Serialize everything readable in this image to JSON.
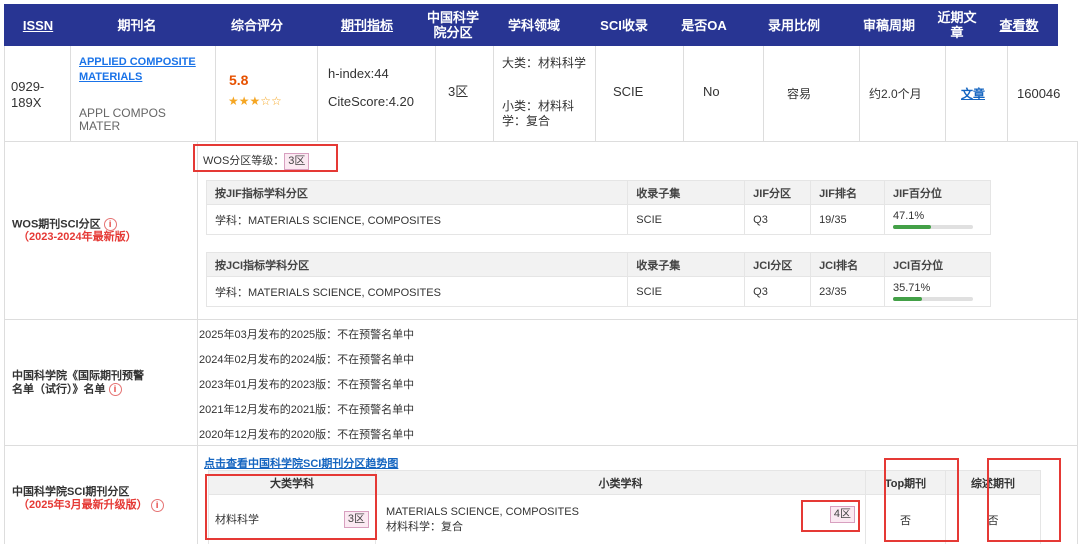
{
  "header": {
    "issn": "ISSN",
    "name": "期刊名",
    "score": "综合评分",
    "metrics": "期刊指标",
    "cas_zone": "中国科学院分区",
    "field": "学科领域",
    "sci": "SCI收录",
    "oa": "是否OA",
    "acceptance": "录用比例",
    "review": "审稿周期",
    "recent": "近期文章",
    "views": "查看数"
  },
  "journal": {
    "issn": "0929-189X",
    "title": "APPLIED COMPOSITE MATERIALS",
    "abbr": "APPL COMPOS MATER",
    "score": "5.8",
    "stars": "★★★☆☆",
    "hindex": "h-index:44",
    "citescore": "CiteScore:4.20",
    "zone": "3区",
    "field_major": "大类：材料科学",
    "field_minor": "小类：材料科学：复合",
    "sci": "SCIE",
    "oa": "No",
    "acceptance": "容易",
    "review": "约2.0个月",
    "recent": "文章",
    "views": "160046"
  },
  "wos": {
    "label": "WOS期刊SCI分区",
    "sub_label": "（2023-2024年最新版）",
    "grade_label": "WOS分区等级：",
    "grade": "3区",
    "jif": {
      "headers": [
        "按JIF指标学科分区",
        "收录子集",
        "JIF分区",
        "JIF排名",
        "JIF百分位"
      ],
      "subject": "学科：MATERIALS SCIENCE, COMPOSITES",
      "collection": "SCIE",
      "quartile": "Q3",
      "rank": "19/35",
      "percentile": "47.1%",
      "percentile_value": 47.1
    },
    "jci": {
      "headers": [
        "按JCI指标学科分区",
        "收录子集",
        "JCI分区",
        "JCI排名",
        "JCI百分位"
      ],
      "subject": "学科：MATERIALS SCIENCE, COMPOSITES",
      "collection": "SCIE",
      "quartile": "Q3",
      "rank": "23/35",
      "percentile": "35.71%",
      "percentile_value": 35.71
    }
  },
  "warning": {
    "label_line1": "中国科学院《国际期刊预警",
    "label_line2": "名单（试行）》名单",
    "lines": [
      "2025年03月发布的2025版：不在预警名单中",
      "2024年02月发布的2024版：不在预警名单中",
      "2023年01月发布的2023版：不在预警名单中",
      "2021年12月发布的2021版：不在预警名单中",
      "2020年12月发布的2020版：不在预警名单中"
    ]
  },
  "cas": {
    "label": "中国科学院SCI期刊分区",
    "sub_label": "（2025年3月最新升级版）",
    "trend_link": "点击查看中国科学院SCI期刊分区趋势图",
    "headers": {
      "major": "大类学科",
      "minor": "小类学科",
      "top": "Top期刊",
      "review": "综述期刊"
    },
    "major": "材料科学",
    "major_zone": "3区",
    "minor_en": "MATERIALS SCIENCE, COMPOSITES",
    "minor_cn": "材料科学：复合",
    "minor_zone": "4区",
    "top": "否",
    "review": "否"
  }
}
